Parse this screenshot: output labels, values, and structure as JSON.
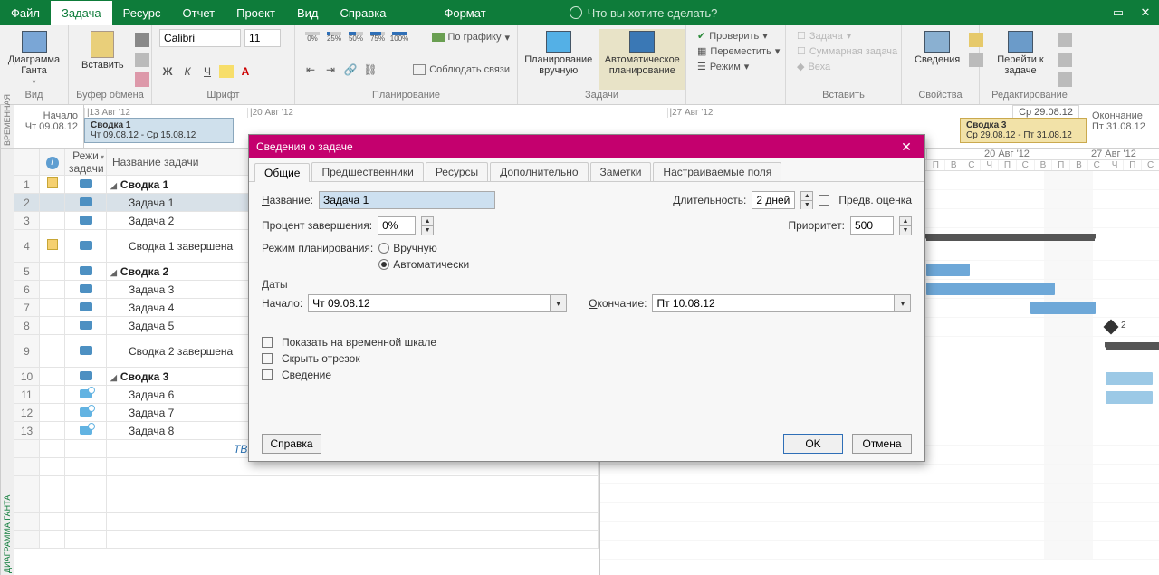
{
  "menu": {
    "items": [
      "Файл",
      "Задача",
      "Ресурс",
      "Отчет",
      "Проект",
      "Вид",
      "Справка",
      "Формат"
    ],
    "active": "Задача",
    "tell_me": "Что вы хотите сделать?"
  },
  "ribbon": {
    "view_label": "Диаграмма Ганта",
    "group_view": "Вид",
    "paste_label": "Вставить",
    "group_clipboard": "Буфер обмена",
    "font_name": "Calibri",
    "font_size": "11",
    "group_font": "Шрифт",
    "pcts": [
      "0%",
      "25%",
      "50%",
      "75%",
      "100%"
    ],
    "by_schedule": "По графику",
    "respect_links": "Соблюдать связи",
    "group_schedule": "Планирование",
    "manual_label": "Планирование вручную",
    "auto_label": "Автоматическое планирование",
    "group_tasks": "Задачи",
    "check": "Проверить",
    "move": "Переместить",
    "mode": "Режим",
    "task": "Задача",
    "summary_task": "Суммарная задача",
    "milestone": "Веха",
    "group_insert": "Вставить",
    "info": "Сведения",
    "group_props": "Свойства",
    "goto_task": "Перейти к задаче",
    "group_edit": "Редактирование"
  },
  "timeline": {
    "side": "ВРЕМЕННАЯ",
    "start_label": "Начало",
    "start_date": "Чт 09.08.12",
    "end_label": "Окончание",
    "end_date": "Пт 31.08.12",
    "ticks": [
      "|13 Авг '12",
      "|20 Авг '12",
      "|27 Авг '12"
    ],
    "bars": [
      {
        "title": "Сводка 1",
        "range": "Чт 09.08.12 - Ср 15.08.12"
      },
      {
        "title": "Сводка 3",
        "range": "Ср 29.08.12 - Пт 31.08.12"
      }
    ],
    "chip": "Ср 29.08.12"
  },
  "grid": {
    "side": "ДИАГРАММА ГАНТА",
    "headers": {
      "mode": "Режи<br>задачи",
      "name": "Название задачи"
    },
    "rows": [
      {
        "n": "1",
        "info": "note",
        "mode": "auto",
        "name": "Сводка 1",
        "summary": true
      },
      {
        "n": "2",
        "mode": "auto",
        "name": "Задача 1",
        "indent": 1,
        "selected": true
      },
      {
        "n": "3",
        "mode": "auto",
        "name": "Задача 2",
        "indent": 1
      },
      {
        "n": "4",
        "info": "note",
        "mode": "auto",
        "name": "Сводка 1 завершена",
        "indent": 1,
        "tall": true
      },
      {
        "n": "5",
        "mode": "auto",
        "name": "Сводка 2",
        "summary": true
      },
      {
        "n": "6",
        "mode": "auto",
        "name": "Задача 3",
        "indent": 1
      },
      {
        "n": "7",
        "mode": "auto",
        "name": "Задача 4",
        "indent": 1
      },
      {
        "n": "8",
        "mode": "auto",
        "name": "Задача 5",
        "indent": 1
      },
      {
        "n": "9",
        "mode": "auto",
        "name": "Сводка 2 завершена",
        "indent": 1,
        "tall": true
      },
      {
        "n": "10",
        "mode": "auto",
        "name": "Сводка 3",
        "summary": true
      },
      {
        "n": "11",
        "mode": "manual",
        "name": "Задача 6",
        "indent": 1
      },
      {
        "n": "12",
        "mode": "manual",
        "name": "Задача 7",
        "indent": 1
      },
      {
        "n": "13",
        "mode": "manual",
        "name": "Задача 8",
        "indent": 1
      }
    ],
    "tbd": "TBD"
  },
  "gantt": {
    "weeks": [
      "20 Авг '12",
      "27 Авг '12"
    ],
    "days": [
      "П",
      "В",
      "С",
      "Ч",
      "П",
      "С",
      "В",
      "П",
      "В",
      "С",
      "Ч",
      "П",
      "С"
    ]
  },
  "modal": {
    "title": "Сведения о задаче",
    "tabs": [
      "Общие",
      "Предшественники",
      "Ресурсы",
      "Дополнительно",
      "Заметки",
      "Настраиваемые поля"
    ],
    "active_tab": "Общие",
    "name_label": "Название:",
    "name_value": "Задача 1",
    "duration_label": "Длительность:",
    "duration_value": "2 дней",
    "estimate_label": "Предв. оценка",
    "percent_label": "Процент завершения:",
    "percent_value": "0%",
    "priority_label": "Приоритет:",
    "priority_value": "500",
    "sched_mode_label": "Режим планирования:",
    "sched_manual": "Вручную",
    "sched_auto": "Автоматически",
    "dates_label": "Даты",
    "start_label": "Начало:",
    "start_value": "Чт 09.08.12",
    "finish_label": "Окончание:",
    "finish_value": "Пт 10.08.12",
    "opt_timeline": "Показать на временной шкале",
    "opt_hide": "Скрыть отрезок",
    "opt_rollup": "Сведение",
    "help": "Справка",
    "ok": "OK",
    "cancel": "Отмена"
  }
}
